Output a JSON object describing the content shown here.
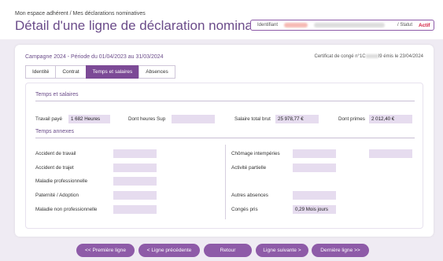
{
  "header": {
    "breadcrumb": "Mon espace adhérent / Mes déclarations nominatives",
    "title": "Détail d'une ligne de déclaration nominative",
    "identifiant_label": "Identifiant",
    "statut_label": "/ Statut",
    "statut_value": "Actif"
  },
  "card": {
    "campaign": "Campagne 2024 - Période du 01/04/2023 au 31/03/2024",
    "certificate_prefix": "Certificat de congé n°1C",
    "certificate_suffix": "I9 émis le 23/04/2024",
    "tabs": [
      {
        "label": "Identité",
        "active": false
      },
      {
        "label": "Contrat",
        "active": false
      },
      {
        "label": "Temps et salaires",
        "active": true
      },
      {
        "label": "Absences",
        "active": false
      }
    ]
  },
  "salaires": {
    "title": "Temps et salaires",
    "travail_paye_label": "Travail payé",
    "travail_paye_value": "1 682 Heures",
    "heures_sup_label": "Dont heures Sup",
    "heures_sup_value": "",
    "salaire_brut_label": "Salaire total brut",
    "salaire_brut_value": "25 978,77 €",
    "primes_label": "Dont primes",
    "primes_value": "2 012,40 €"
  },
  "annexes": {
    "title": "Temps annexes",
    "left": [
      {
        "label": "Accident de travail",
        "value": ""
      },
      {
        "label": "Accident de trajet",
        "value": ""
      },
      {
        "label": "Maladie professionnelle",
        "value": ""
      },
      {
        "label": "Paternité / Adoption",
        "value": ""
      },
      {
        "label": "Maladie non professionnelle",
        "value": ""
      }
    ],
    "right": [
      {
        "label": "Chômage intempéries",
        "value": ""
      },
      {
        "label": "Activité partielle",
        "value": ""
      },
      {
        "label": "Autres absences",
        "value": ""
      },
      {
        "label": "Congés pris",
        "value": "0,29 Mois jours"
      }
    ]
  },
  "buttons": {
    "first": "<< Première ligne",
    "prev": "< Ligne précédente",
    "back": "Retour",
    "next": "Ligne suivante >",
    "last": "Dernière ligne >>"
  }
}
